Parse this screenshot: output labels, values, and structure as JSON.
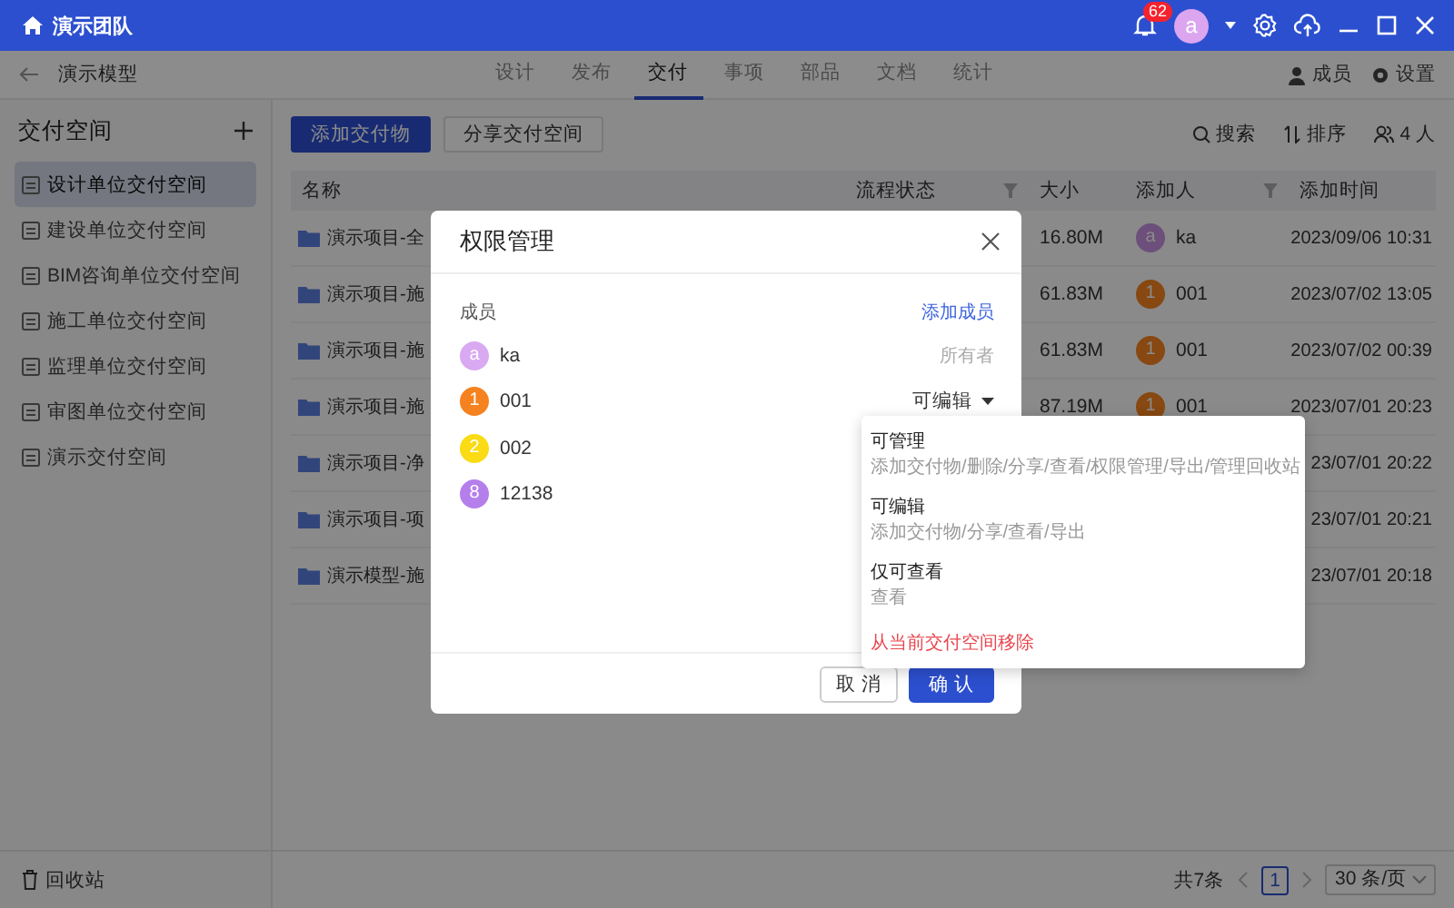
{
  "titlebar": {
    "team": "演示团队",
    "notification_count": "62",
    "avatar": "a"
  },
  "subnav": {
    "title": "演示模型",
    "tabs": [
      {
        "label": "设计",
        "selected": false
      },
      {
        "label": "发布",
        "selected": false
      },
      {
        "label": "交付",
        "selected": true
      },
      {
        "label": "事项",
        "selected": false
      },
      {
        "label": "部品",
        "selected": false
      },
      {
        "label": "文档",
        "selected": false
      },
      {
        "label": "统计",
        "selected": false
      }
    ],
    "members": "成员",
    "settings": "设置"
  },
  "sidebar": {
    "title": "交付空间",
    "items": [
      {
        "label": "设计单位交付空间",
        "selected": true
      },
      {
        "label": "建设单位交付空间",
        "selected": false
      },
      {
        "label": "BIM咨询单位交付空间",
        "selected": false
      },
      {
        "label": "施工单位交付空间",
        "selected": false
      },
      {
        "label": "监理单位交付空间",
        "selected": false
      },
      {
        "label": "审图单位交付空间",
        "selected": false
      },
      {
        "label": "演示交付空间",
        "selected": false
      }
    ],
    "recycle": "回收站"
  },
  "toolbar": {
    "buttons": [
      "添加交付物",
      "分享交付空间"
    ],
    "search": "搜索",
    "sort": "排序",
    "people": "4 人"
  },
  "table": {
    "columns": [
      "名称",
      "流程状态",
      "大小",
      "添加人",
      "添加时间"
    ],
    "rows": [
      {
        "name": "演示项目-全",
        "size": "16.80M",
        "adder": {
          "initial": "a",
          "name": "ka",
          "color": "#6c4f7b"
        },
        "time": "2023/09/06 10:31"
      },
      {
        "name": "演示项目-施",
        "size": "61.83M",
        "adder": {
          "initial": "1",
          "name": "001",
          "color": "#874811"
        },
        "time": "2023/07/02 13:05"
      },
      {
        "name": "演示项目-施",
        "size": "61.83M",
        "adder": {
          "initial": "1",
          "name": "001",
          "color": "#874811"
        },
        "time": "2023/07/02 00:39"
      },
      {
        "name": "演示项目-施",
        "size": "87.19M",
        "adder": {
          "initial": "1",
          "name": "001",
          "color": "#874811"
        },
        "time": "2023/07/01 20:23"
      },
      {
        "name": "演示项目-净",
        "time": "23/07/01 20:22"
      },
      {
        "name": "演示项目-项",
        "time": "23/07/01 20:21"
      },
      {
        "name": "演示模型-施",
        "time": "23/07/01 20:18"
      }
    ]
  },
  "pagination": {
    "total": "共7条",
    "page": "1",
    "page_size": "30 条/页"
  },
  "dialog": {
    "title": "权限管理",
    "members_label": "成员",
    "add_member": "添加成员",
    "members": [
      {
        "initial": "a",
        "name": "ka",
        "color": "#d9aaf2",
        "kind": "owner",
        "role": "所有者"
      },
      {
        "initial": "1",
        "name": "001",
        "color": "#f5821f",
        "kind": "dropdown",
        "role": "可编辑"
      },
      {
        "initial": "2",
        "name": "002",
        "color": "#fadb14"
      },
      {
        "initial": "8",
        "name": "12138",
        "color": "#b57feb"
      }
    ],
    "cancel": "取 消",
    "confirm": "确 认"
  },
  "role_menu": {
    "options": [
      {
        "title": "可管理",
        "description": "添加交付物/删除/分享/查看/权限管理/导出/管理回收站"
      },
      {
        "title": "可编辑",
        "description": "添加交付物/分享/查看/导出"
      },
      {
        "title": "仅可查看",
        "description": "查看"
      }
    ],
    "remove": "从当前交付空间移除"
  }
}
